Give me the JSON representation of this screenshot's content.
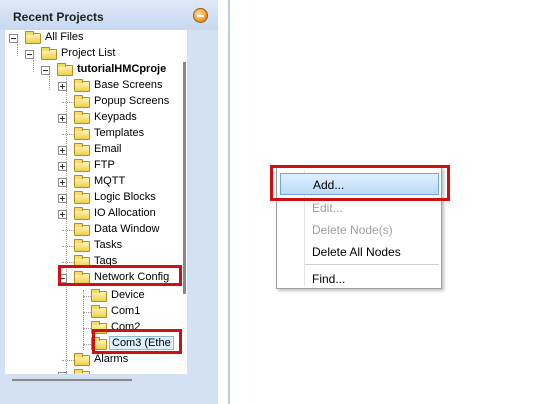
{
  "panel": {
    "title": "Recent Projects"
  },
  "tree": {
    "all_files": "All Files",
    "project_list": "Project List",
    "project_name": "tutorialHMCproje",
    "items": [
      "Base Screens",
      "Popup Screens",
      "Keypads",
      "Templates",
      "Email",
      "FTP",
      "MQTT",
      "Logic Blocks",
      "IO Allocation",
      "Data Window",
      "Tasks",
      "Tags"
    ],
    "network_config": "Network Config",
    "network_children": [
      "Device",
      "Com1",
      "Com2",
      "Com3 (Ethe"
    ],
    "after_network": [
      "Alarms"
    ]
  },
  "context_menu": {
    "add": "Add...",
    "edit": "Edit...",
    "delete_nodes": "Delete Node(s)",
    "delete_all": "Delete All Nodes",
    "find": "Find..."
  },
  "colors": {
    "highlight": "#d01010",
    "panel_bg": "#d4e1f4"
  }
}
